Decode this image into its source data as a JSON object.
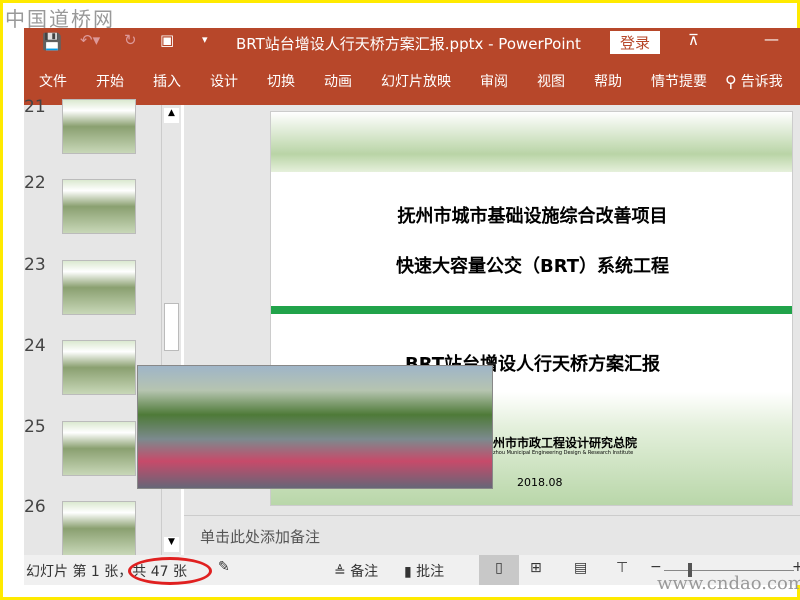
{
  "watermark_top": "中国道桥网",
  "watermark_bottom": "www.cndao.com",
  "titlebar": {
    "title": "BRT站台增设人行天桥方案汇报.pptx  -  PowerPoint",
    "login": "登录"
  },
  "ribbon": {
    "tabs": [
      "文件",
      "开始",
      "插入",
      "设计",
      "切换",
      "动画",
      "幻灯片放映",
      "审阅",
      "视图",
      "帮助",
      "情节提要"
    ],
    "tell_me": "告诉我"
  },
  "thumbnails": [
    "21",
    "22",
    "23",
    "24",
    "25",
    "26"
  ],
  "slide": {
    "line1": "抚州市城市基础设施综合改善项目",
    "line2": "快速大容量公交（BRT）系统工程",
    "line3": "BRT站台增设人行天桥方案汇报",
    "org": "州市市政工程设计研究总院",
    "org_en": "zhou Municipal Engineering Design & Research Institute",
    "date": "2018.08"
  },
  "notes_placeholder": "单击此处添加备注",
  "status": {
    "slide_info": "幻灯片 第 1 张，共 47 张",
    "notes": "备注",
    "comments": "批注"
  },
  "colors": {
    "brand": "#B7472A",
    "accent_green": "#21A34A"
  }
}
